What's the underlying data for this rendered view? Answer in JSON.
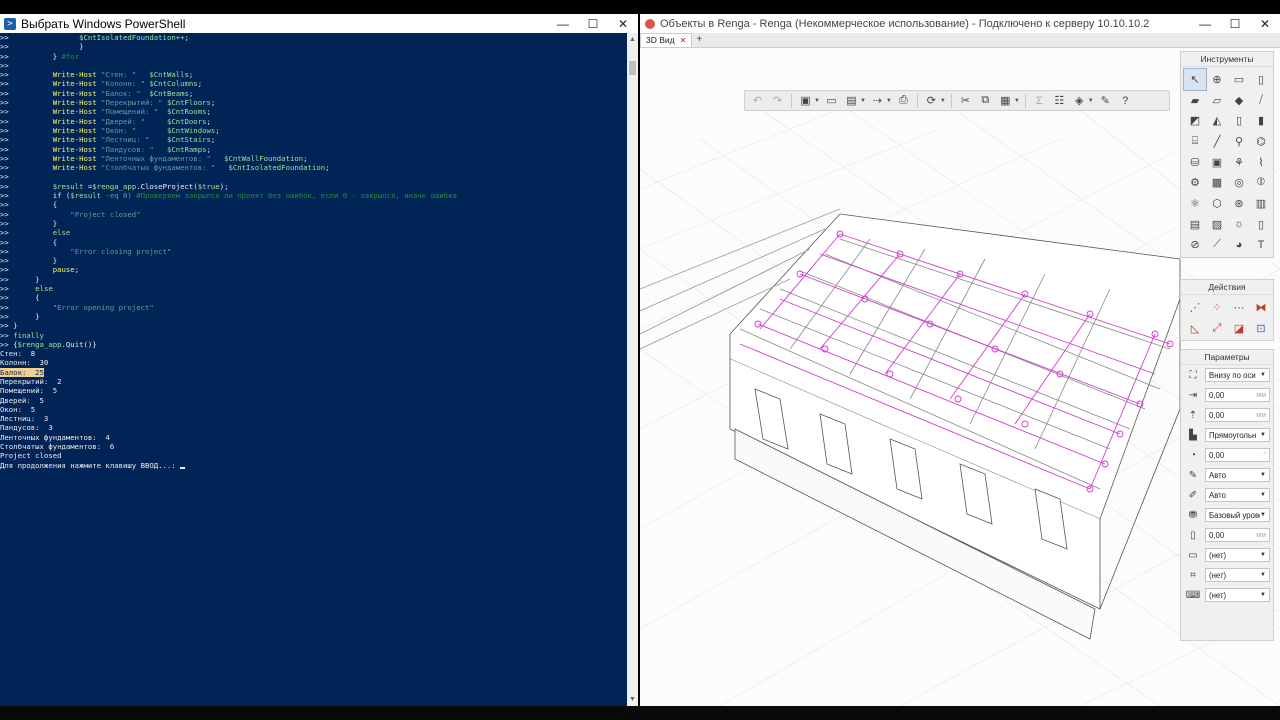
{
  "powershell": {
    "title": "Выбрать Windows PowerShell",
    "controls": {
      "minimize": "—",
      "maximize": "☐",
      "close": "✕"
    },
    "lines": [
      [
        {
          "t": ">>                ",
          "c": "pre"
        },
        {
          "t": "$CntIsolatedFoundation++",
          "c": "var"
        },
        {
          "t": ";",
          "c": "pre"
        }
      ],
      [
        {
          "t": ">>                }",
          "c": "pre"
        }
      ],
      [
        {
          "t": ">>          } ",
          "c": "pre"
        },
        {
          "t": "#for",
          "c": "cmt"
        }
      ],
      [
        {
          "t": ">>",
          "c": "pre"
        }
      ],
      [
        {
          "t": ">>          ",
          "c": "pre"
        },
        {
          "t": "Write-Host",
          "c": "cmd"
        },
        {
          "t": " \"Стен: \"   ",
          "c": "str"
        },
        {
          "t": "$CntWalls",
          "c": "var"
        },
        {
          "t": ";",
          "c": "pre"
        }
      ],
      [
        {
          "t": ">>          ",
          "c": "pre"
        },
        {
          "t": "Write-Host",
          "c": "cmd"
        },
        {
          "t": " \"Колонн: \" ",
          "c": "str"
        },
        {
          "t": "$CntColumns",
          "c": "var"
        },
        {
          "t": ";",
          "c": "pre"
        }
      ],
      [
        {
          "t": ">>          ",
          "c": "pre"
        },
        {
          "t": "Write-Host",
          "c": "cmd"
        },
        {
          "t": " \"Балок: \"  ",
          "c": "str"
        },
        {
          "t": "$CntBeams",
          "c": "var"
        },
        {
          "t": ";",
          "c": "pre"
        }
      ],
      [
        {
          "t": ">>          ",
          "c": "pre"
        },
        {
          "t": "Write-Host",
          "c": "cmd"
        },
        {
          "t": " \"Перекрытий: \" ",
          "c": "str"
        },
        {
          "t": "$CntFloors",
          "c": "var"
        },
        {
          "t": ";",
          "c": "pre"
        }
      ],
      [
        {
          "t": ">>          ",
          "c": "pre"
        },
        {
          "t": "Write-Host",
          "c": "cmd"
        },
        {
          "t": " \"Помещений: \"  ",
          "c": "str"
        },
        {
          "t": "$CntRooms",
          "c": "var"
        },
        {
          "t": ";",
          "c": "pre"
        }
      ],
      [
        {
          "t": ">>          ",
          "c": "pre"
        },
        {
          "t": "Write-Host",
          "c": "cmd"
        },
        {
          "t": " \"Дверей: \"     ",
          "c": "str"
        },
        {
          "t": "$CntDoors",
          "c": "var"
        },
        {
          "t": ";",
          "c": "pre"
        }
      ],
      [
        {
          "t": ">>          ",
          "c": "pre"
        },
        {
          "t": "Write-Host",
          "c": "cmd"
        },
        {
          "t": " \"Окон: \"       ",
          "c": "str"
        },
        {
          "t": "$CntWindows",
          "c": "var"
        },
        {
          "t": ";",
          "c": "pre"
        }
      ],
      [
        {
          "t": ">>          ",
          "c": "pre"
        },
        {
          "t": "Write-Host",
          "c": "cmd"
        },
        {
          "t": " \"Лестниц: \"    ",
          "c": "str"
        },
        {
          "t": "$CntStairs",
          "c": "var"
        },
        {
          "t": ";",
          "c": "pre"
        }
      ],
      [
        {
          "t": ">>          ",
          "c": "pre"
        },
        {
          "t": "Write-Host",
          "c": "cmd"
        },
        {
          "t": " \"Пандусов: \"   ",
          "c": "str"
        },
        {
          "t": "$CntRamps",
          "c": "var"
        },
        {
          "t": ";",
          "c": "pre"
        }
      ],
      [
        {
          "t": ">>          ",
          "c": "pre"
        },
        {
          "t": "Write-Host",
          "c": "cmd"
        },
        {
          "t": " \"Ленточных фундаментов: \"   ",
          "c": "str"
        },
        {
          "t": "$CntWallFoundation",
          "c": "var"
        },
        {
          "t": ";",
          "c": "pre"
        }
      ],
      [
        {
          "t": ">>          ",
          "c": "pre"
        },
        {
          "t": "Write-Host",
          "c": "cmd"
        },
        {
          "t": " \"Столбчатых фундаментов: \"   ",
          "c": "str"
        },
        {
          "t": "$CntIsolatedFoundation",
          "c": "var"
        },
        {
          "t": ";",
          "c": "pre"
        }
      ],
      [
        {
          "t": ">>",
          "c": "pre"
        }
      ],
      [
        {
          "t": ">>          ",
          "c": "pre"
        },
        {
          "t": "$result",
          "c": "var"
        },
        {
          "t": " =",
          "c": "pre"
        },
        {
          "t": "$renga_app",
          "c": "var"
        },
        {
          "t": ".CloseProject(",
          "c": "pre"
        },
        {
          "t": "$true",
          "c": "var"
        },
        {
          "t": ");",
          "c": "pre"
        }
      ],
      [
        {
          "t": ">>          if (",
          "c": "pre"
        },
        {
          "t": "$result",
          "c": "var"
        },
        {
          "t": " -eq 0) ",
          "c": "str"
        },
        {
          "t": "#Проверяем закрылся ли проект без ошибок, если 0 - закрылся, иначе ошибка",
          "c": "cmt"
        }
      ],
      [
        {
          "t": ">>          {",
          "c": "pre"
        }
      ],
      [
        {
          "t": ">>              ",
          "c": "pre"
        },
        {
          "t": "\"Project closed\"",
          "c": "str"
        }
      ],
      [
        {
          "t": ">>          }",
          "c": "pre"
        }
      ],
      [
        {
          "t": ">>          ",
          "c": "pre"
        },
        {
          "t": "else",
          "c": "kw"
        }
      ],
      [
        {
          "t": ">>          {",
          "c": "pre"
        }
      ],
      [
        {
          "t": ">>              ",
          "c": "pre"
        },
        {
          "t": "\"Error closing project\"",
          "c": "str"
        }
      ],
      [
        {
          "t": ">>          }",
          "c": "pre"
        }
      ],
      [
        {
          "t": ">>          ",
          "c": "pre"
        },
        {
          "t": "pause",
          "c": "cmd"
        },
        {
          "t": ";",
          "c": "pre"
        }
      ],
      [
        {
          "t": ">>      }",
          "c": "pre"
        }
      ],
      [
        {
          "t": ">>      ",
          "c": "pre"
        },
        {
          "t": "else",
          "c": "kw"
        }
      ],
      [
        {
          "t": ">>      {",
          "c": "pre"
        }
      ],
      [
        {
          "t": ">>          ",
          "c": "pre"
        },
        {
          "t": "\"Error opening project\"",
          "c": "str"
        }
      ],
      [
        {
          "t": ">>      }",
          "c": "pre"
        }
      ],
      [
        {
          "t": ">> }",
          "c": "pre"
        }
      ],
      [
        {
          "t": ">> ",
          "c": "pre"
        },
        {
          "t": "finally",
          "c": "kw"
        }
      ],
      [
        {
          "t": ">> {",
          "c": "pre"
        },
        {
          "t": "$renga_app",
          "c": "var"
        },
        {
          "t": ".Quit()}",
          "c": "pre"
        }
      ],
      [
        {
          "t": "Стен:  8",
          "c": "pre"
        }
      ],
      [
        {
          "t": "Колонн:  30",
          "c": "pre"
        }
      ],
      [
        {
          "t": "Балок:  25",
          "c": "hl"
        }
      ],
      [
        {
          "t": "Перекрытий:  2",
          "c": "pre"
        }
      ],
      [
        {
          "t": "Помещений:  5",
          "c": "pre"
        }
      ],
      [
        {
          "t": "Дверей:  5",
          "c": "pre"
        }
      ],
      [
        {
          "t": "Окон:  5",
          "c": "pre"
        }
      ],
      [
        {
          "t": "Лестниц:  3",
          "c": "pre"
        }
      ],
      [
        {
          "t": "Пандусов:  3",
          "c": "pre"
        }
      ],
      [
        {
          "t": "Ленточных фундаментов:  4",
          "c": "pre"
        }
      ],
      [
        {
          "t": "Столбчатых фундаментов:  6",
          "c": "pre"
        }
      ],
      [
        {
          "t": "Project closed",
          "c": "pre"
        }
      ],
      [
        {
          "t": "Для продолжения нажмите клавишу ВВОД...: ",
          "c": "pre"
        },
        {
          "t": "",
          "c": "cursor"
        }
      ]
    ]
  },
  "renga": {
    "title": "Объекты в Renga - Renga (Некоммерческое использование) - Подключено к серверу 10.10.10.2",
    "tab_label": "3D Вид",
    "tab_close": "✕",
    "tab_add": "+",
    "toolbar_icons": [
      "undo-icon",
      "redo-icon",
      "view-cube-icon",
      "open-icon",
      "save-icon",
      "export-icon",
      "print-icon",
      "orbit-icon",
      "cut-icon",
      "copy-icon",
      "paste-icon",
      "sum-icon",
      "properties-icon",
      "layers-icon",
      "settings-icon",
      "help-icon"
    ],
    "panels": {
      "tools": {
        "header": "Инструменты",
        "items": [
          "select",
          "column",
          "wall",
          "window",
          "floor",
          "beam",
          "roof",
          "rail",
          "ramp",
          "slab",
          "door",
          "line",
          "stair",
          "opening",
          "equipment",
          "hatch",
          "furniture",
          "pipe",
          "duct",
          "fitting",
          "assembly",
          "plumbing",
          "sensor",
          "valve",
          "element",
          "room",
          "pump",
          "tank",
          "column-frame",
          "foundation",
          "light",
          "lamp",
          "section",
          "dimension",
          "axis",
          "text"
        ]
      },
      "actions": {
        "header": "Действия",
        "items": [
          "move",
          "rotate",
          "array",
          "mirror",
          "align",
          "scale",
          "delete",
          "copy-prop"
        ]
      },
      "params": {
        "header": "Параметры",
        "fields": [
          {
            "icon": "placement-icon",
            "value": "Внизу по оси",
            "unit": "",
            "dropdown": true
          },
          {
            "icon": "offset-icon",
            "value": "0,00",
            "unit": "мм",
            "dropdown": false
          },
          {
            "icon": "height-icon",
            "value": "0,00",
            "unit": "мм",
            "dropdown": false
          },
          {
            "icon": "profile-icon",
            "value": "Прямоугольн",
            "unit": "",
            "dropdown": true
          },
          {
            "icon": "angle-icon",
            "value": "0,00",
            "unit": "°",
            "dropdown": false
          },
          {
            "icon": "material-icon",
            "value": "Авто",
            "unit": "",
            "dropdown": true
          },
          {
            "icon": "style-icon",
            "value": "Авто",
            "unit": "",
            "dropdown": true
          },
          {
            "icon": "level-icon",
            "value": "Базовый уровень",
            "unit": "",
            "dropdown": true
          },
          {
            "icon": "elevation-icon",
            "value": "0,00",
            "unit": "мм",
            "dropdown": false
          },
          {
            "icon": "mark-icon",
            "value": "(нет)",
            "unit": "",
            "dropdown": true
          },
          {
            "icon": "grid-icon",
            "value": "(нет)",
            "unit": "",
            "dropdown": true
          },
          {
            "icon": "tag-icon",
            "value": "(нет)",
            "unit": "",
            "dropdown": true
          }
        ]
      }
    }
  }
}
